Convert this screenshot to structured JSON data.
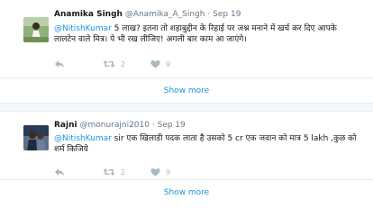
{
  "tweets": [
    {
      "name": "Anamika Singh",
      "handle": "@Anamika_A_Singh",
      "dot": "·",
      "time": "Sep 19",
      "mention": "@NitishKumar",
      "text": " 5 लाख? इतना तो शहाबुद्दीन के रिहाई पर जश्न मनाने में खर्च कर दिए आपके लालटेन वाले मित्र। पे भी रख लीजिए! अगली बार काम आ जाएंगे।",
      "reply_count": "",
      "retweet_count": "2",
      "like_count": "9",
      "show_more": "Show more"
    },
    {
      "name": "Rajni",
      "handle": "@monurajni2010",
      "dot": "·",
      "time": "Sep 19",
      "mention": "@NitishKumar",
      "text": " sir एक खिलाडी पदक लाता है उसको 5 cr एक जवान को मात्र 5 lakh ,कुछ को शर्म किजिये",
      "reply_count": "",
      "retweet_count": "2",
      "like_count": "9",
      "show_more": "Show more"
    }
  ],
  "colors": {
    "link": "#1b95e0",
    "muted": "#657786",
    "icon": "#aab8c2",
    "background": "#f5f8fa"
  },
  "icons": [
    "reply-icon",
    "retweet-icon",
    "like-icon"
  ]
}
